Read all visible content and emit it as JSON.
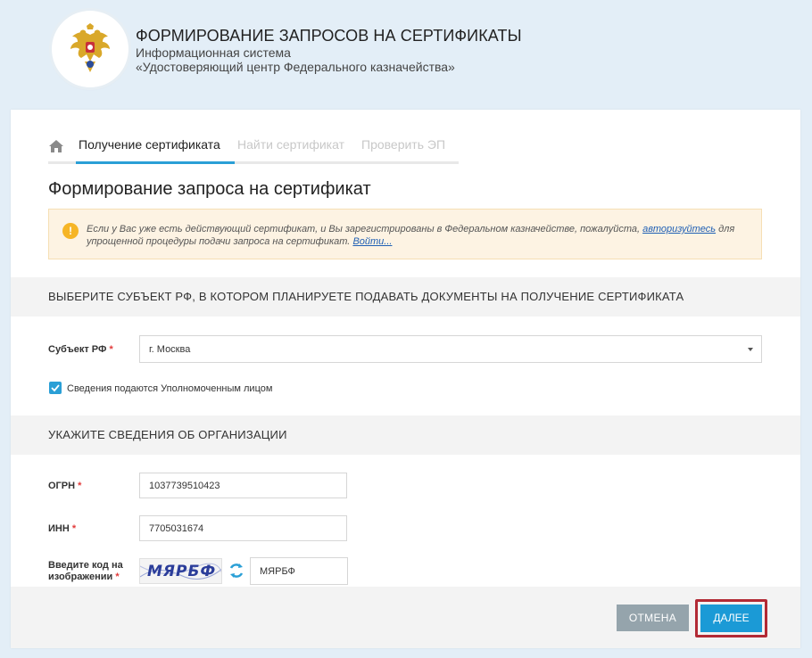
{
  "header": {
    "title": "ФОРМИРОВАНИЕ ЗАПРОСОВ НА СЕРТИФИКАТЫ",
    "subtitle1": "Информационная система",
    "subtitle2": "«Удостоверяющий центр Федерального казначейства»",
    "logo_icon": "emblem-icon"
  },
  "tabs": [
    {
      "label": "Получение сертификата",
      "active": true
    },
    {
      "label": "Найти сертификат",
      "active": false
    },
    {
      "label": "Проверить ЭП",
      "active": false
    }
  ],
  "page_title": "Формирование запроса на сертификат",
  "alert": {
    "text_before": "Если у Вас уже есть действующий сертификат, и Вы зарегистрированы в Федеральном казначействе, пожалуйста, ",
    "link1": "авторизуйтесь",
    "text_after": " для упрощенной процедуры подачи запроса на сертификат. ",
    "link2": "Войти..."
  },
  "section1": {
    "title": "ВЫБЕРИТЕ СУБЪЕКТ РФ, В КОТОРОМ ПЛАНИРУЕТЕ ПОДАВАТЬ ДОКУМЕНТЫ НА ПОЛУЧЕНИЕ СЕРТИФИКАТА",
    "region_label": "Субъект РФ",
    "region_value": "г. Москва",
    "checkbox_label": "Сведения подаются Уполномоченным лицом",
    "checkbox_checked": true
  },
  "section2": {
    "title": "УКАЖИТЕ СВЕДЕНИЯ ОБ ОРГАНИЗАЦИИ",
    "ogrn_label": "ОГРН",
    "ogrn_value": "1037739510423",
    "inn_label": "ИНН",
    "inn_value": "7705031674",
    "captcha_label_line1": "Введите код на",
    "captcha_label_line2": "изображении",
    "captcha_image_text": "МЯРБФ",
    "captcha_value": "МЯРБФ"
  },
  "required_mark": "*",
  "footer": {
    "cancel_label": "ОТМЕНА",
    "next_label": "ДАЛЕЕ"
  },
  "colors": {
    "accent": "#2a9fd6",
    "button_next": "#1b9ad6",
    "button_cancel": "#95a4ac",
    "highlight_border": "#b22a35",
    "required": "#e23b3b"
  }
}
